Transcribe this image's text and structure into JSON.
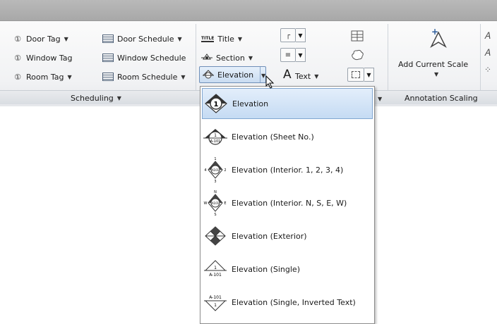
{
  "ribbon": {
    "scheduling": {
      "tags": [
        "Door Tag",
        "Window Tag",
        "Room Tag"
      ],
      "schedules": [
        "Door Schedule",
        "Window Schedule",
        "Room Schedule"
      ],
      "panel_title": "Scheduling"
    },
    "callouts": {
      "title_label": "Title",
      "title_icon_text": "TITLE",
      "section_label": "Section",
      "elevation_label": "Elevation"
    },
    "text_tools": {
      "text_label": "Text"
    },
    "annotation_scaling": {
      "add_current_scale_label": "Add Current Scale",
      "panel_title": "Annotation Scaling"
    }
  },
  "elevation_menu": {
    "items": [
      {
        "label": "Elevation",
        "icon": "elevation-circle-icon",
        "selected": true
      },
      {
        "label": "Elevation (Sheet No.)",
        "icon": "elevation-sheet-no-icon"
      },
      {
        "label": "Elevation (Interior. 1, 2, 3, 4)",
        "icon": "elevation-interior-numbers-icon"
      },
      {
        "label": "Elevation (Interior. N, S, E, W)",
        "icon": "elevation-interior-compass-icon"
      },
      {
        "label": "Elevation (Exterior)",
        "icon": "elevation-exterior-icon"
      },
      {
        "label": "Elevation (Single)",
        "icon": "elevation-single-icon"
      },
      {
        "label": "Elevation (Single, Inverted Text)",
        "icon": "elevation-single-inverted-icon"
      }
    ]
  },
  "icon_text": {
    "circle_number": "1",
    "sheet_number": "1",
    "sheet_sub": "A-101",
    "interior_numbers": [
      "1",
      "2",
      "3",
      "4"
    ],
    "interior_center": "A101",
    "compass": [
      "N",
      "E",
      "S",
      "W"
    ],
    "single_top": "1",
    "single_bottom": "A-101",
    "inverted_top": "A-101",
    "inverted_bottom": "1"
  }
}
